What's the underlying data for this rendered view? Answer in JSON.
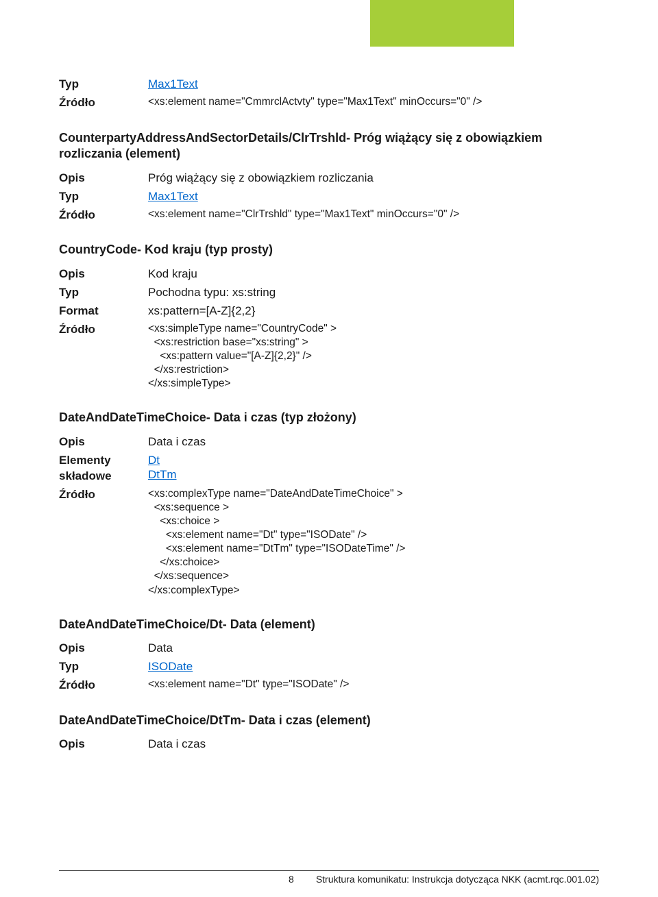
{
  "labels": {
    "typ": "Typ",
    "zrodlo": "Źródło",
    "opis": "Opis",
    "format": "Format",
    "elementy": "Elementy składowe"
  },
  "b1": {
    "typ": "Max1Text",
    "zrodlo": "<xs:element name=\"CmmrclActvty\" type=\"Max1Text\" minOccurs=\"0\" />"
  },
  "s2": {
    "head": "CounterpartyAddressAndSectorDetails/ClrTrshld- Próg wiążący się z obowiązkiem rozliczania (element)",
    "opis": "Próg wiążący się z obowiązkiem rozliczania",
    "typ": "Max1Text",
    "zrodlo": "<xs:element name=\"ClrTrshld\" type=\"Max1Text\" minOccurs=\"0\" />"
  },
  "s3": {
    "head": "CountryCode- Kod kraju (typ prosty)",
    "opis": "Kod kraju",
    "typ": "Pochodna typu: xs:string",
    "format": "xs:pattern=[A-Z]{2,2}",
    "zrodlo": "<xs:simpleType name=\"CountryCode\" >\n  <xs:restriction base=\"xs:string\" >\n    <xs:pattern value=\"[A-Z]{2,2}\" />\n  </xs:restriction>\n</xs:simpleType>"
  },
  "s4": {
    "head": "DateAndDateTimeChoice- Data i czas (typ złożony)",
    "opis": "Data i czas",
    "el1": "Dt",
    "el2": "DtTm",
    "zrodlo": "<xs:complexType name=\"DateAndDateTimeChoice\" >\n  <xs:sequence >\n    <xs:choice >\n      <xs:element name=\"Dt\" type=\"ISODate\" />\n      <xs:element name=\"DtTm\" type=\"ISODateTime\" />\n    </xs:choice>\n  </xs:sequence>\n</xs:complexType>"
  },
  "s5": {
    "head": "DateAndDateTimeChoice/Dt- Data (element)",
    "opis": "Data",
    "typ": "ISODate",
    "zrodlo": "<xs:element name=\"Dt\" type=\"ISODate\" />"
  },
  "s6": {
    "head": "DateAndDateTimeChoice/DtTm- Data i czas (element)",
    "opis": "Data i czas"
  },
  "footer": {
    "page": "8",
    "text": "Struktura komunikatu: Instrukcja dotycząca NKK (acmt.rqc.001.02)"
  }
}
